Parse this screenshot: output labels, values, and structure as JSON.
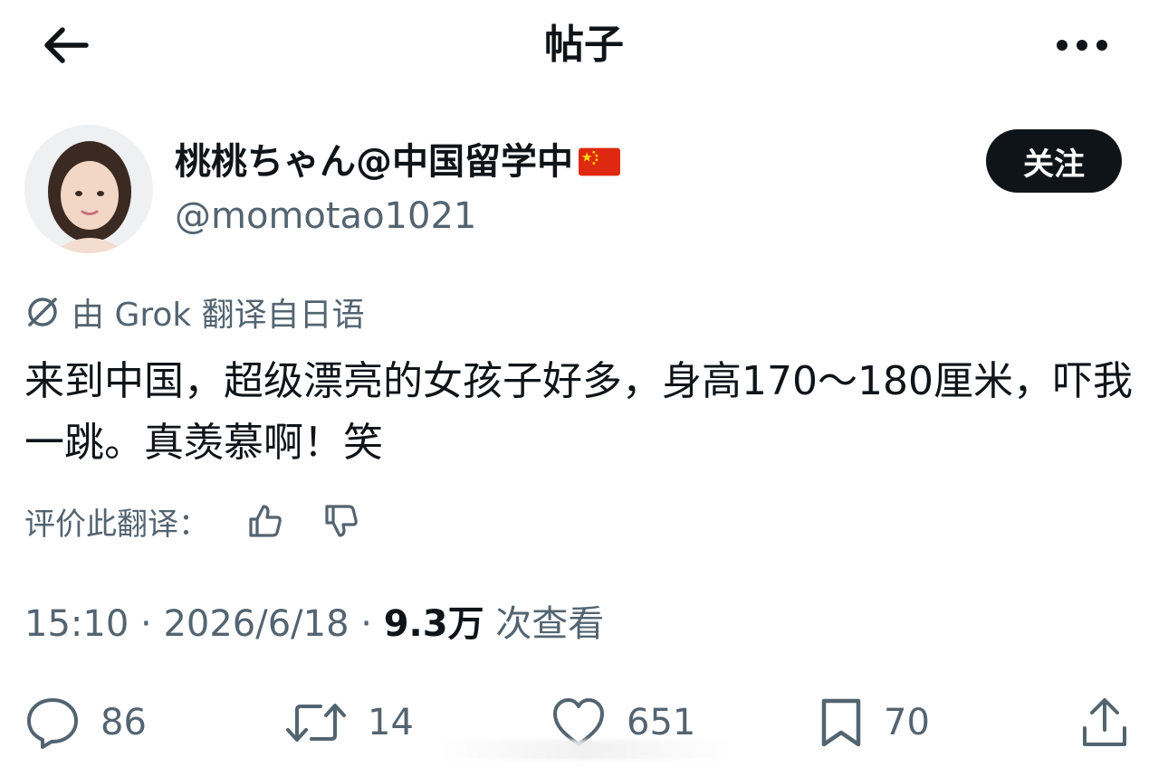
{
  "header": {
    "title": "帖子",
    "back_icon": "arrow-left-icon",
    "more_icon": "more-horizontal-icon"
  },
  "author": {
    "display_name": "桃桃ちゃん@中国留学中",
    "flag_icon": "china-flag-icon",
    "handle": "@momotao1021",
    "follow_label": "关注"
  },
  "translation": {
    "note": "由 Grok 翻译自日语",
    "rate_label": "评价此翻译："
  },
  "post": {
    "text": "来到中国，超级漂亮的女孩子好多，身高170～180厘米，吓我一跳。真羡慕啊！笑",
    "time": "15:10",
    "date": "2026/6/18",
    "views_count": "9.3万",
    "views_label": "次查看",
    "separator": "·"
  },
  "actions": {
    "replies": "86",
    "retweets": "14",
    "likes": "651",
    "bookmarks": "70"
  },
  "colors": {
    "text": "#0f1419",
    "muted": "#536471",
    "flag_red": "#de2910",
    "flag_yellow": "#ffde00"
  }
}
